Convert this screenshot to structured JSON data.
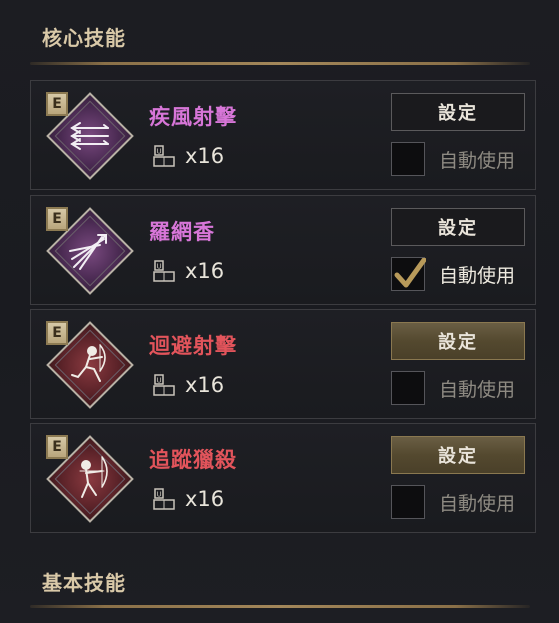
{
  "sections": {
    "core": {
      "title": "核心技能"
    },
    "basic": {
      "title": "基本技能"
    }
  },
  "skills": [
    {
      "name": "疾風射擊",
      "badge": "E",
      "count": "x16",
      "set_label": "設定",
      "auto_label": "自動使用",
      "auto_checked": false,
      "set_active": false,
      "color_theme": "purple",
      "name_color": "#d776d8",
      "icon": "triple-arrows-icon"
    },
    {
      "name": "羅網香",
      "badge": "E",
      "count": "x16",
      "set_label": "設定",
      "auto_label": "自動使用",
      "auto_checked": true,
      "set_active": false,
      "color_theme": "purple",
      "name_color": "#d776d8",
      "icon": "arrow-burst-icon"
    },
    {
      "name": "迴避射擊",
      "badge": "E",
      "count": "x16",
      "set_label": "設定",
      "auto_label": "自動使用",
      "auto_checked": false,
      "set_active": true,
      "color_theme": "red",
      "name_color": "#e2545b",
      "icon": "leaping-archer-icon"
    },
    {
      "name": "追蹤獵殺",
      "badge": "E",
      "count": "x16",
      "set_label": "設定",
      "auto_label": "自動使用",
      "auto_checked": false,
      "set_active": true,
      "color_theme": "red",
      "name_color": "#e2545b",
      "icon": "aiming-archer-icon"
    }
  ],
  "colors": {
    "accent_gold": "#a3875a",
    "purple_bg": "#5a3060",
    "red_bg": "#6a2a30"
  }
}
